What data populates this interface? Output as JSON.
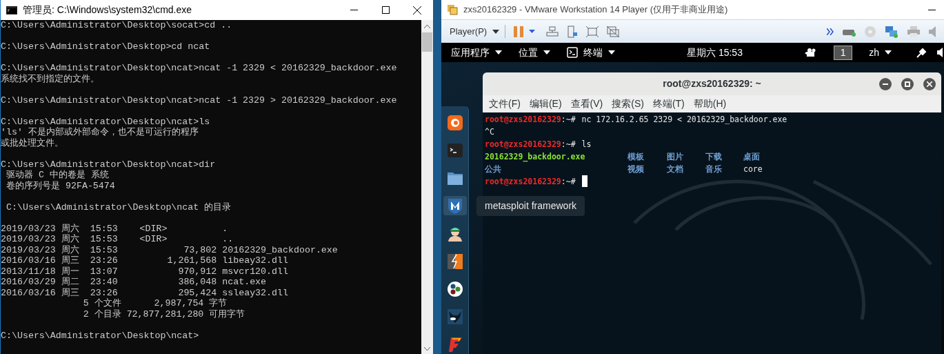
{
  "cmd_window": {
    "title": "管理员: C:\\Windows\\system32\\cmd.exe",
    "blocks": [
      [
        "C:\\Users\\Administrator\\Desktop\\socat>cd .."
      ],
      [
        "C:\\Users\\Administrator\\Desktop>cd ncat"
      ],
      [
        "C:\\Users\\Administrator\\Desktop\\ncat>ncat -1 2329 < 20162329_backdoor.exe",
        "系统找不到指定的文件。"
      ],
      [
        "C:\\Users\\Administrator\\Desktop\\ncat>ncat -1 2329 > 20162329_backdoor.exe"
      ],
      [
        "C:\\Users\\Administrator\\Desktop\\ncat>ls",
        "'ls' 不是内部或外部命令，也不是可运行的程序",
        "或批处理文件。"
      ],
      [
        "C:\\Users\\Administrator\\Desktop\\ncat>dir",
        " 驱动器 C 中的卷是 系统",
        " 卷的序列号是 92FA-5474"
      ],
      [
        " C:\\Users\\Administrator\\Desktop\\ncat 的目录"
      ],
      [
        "2019/03/23 周六  15:53    <DIR>          .",
        "2019/03/23 周六  15:53    <DIR>          ..",
        "2019/03/23 周六  15:53            73,802 20162329_backdoor.exe",
        "2016/03/16 周三  23:26         1,261,568 libeay32.dll",
        "2013/11/18 周一  13:07           970,912 msvcr120.dll",
        "2016/03/29 周二  23:40           386,048 ncat.exe",
        "2016/03/16 周三  23:26           295,424 ssleay32.dll",
        "               5 个文件      2,987,754 字节",
        "               2 个目录 72,877,281,280 可用字节"
      ],
      [
        "C:\\Users\\Administrator\\Desktop\\ncat>"
      ]
    ]
  },
  "vm_window": {
    "title": "zxs20162329 - VMware Workstation 14 Player (仅用于非商业用途)",
    "player_menu": "Player(P)",
    "guest": {
      "top_bar": {
        "menus": [
          {
            "kind": "menu",
            "label": "应用程序"
          },
          {
            "kind": "menu",
            "label": "位置"
          },
          {
            "kind": "terminal",
            "label": "终端"
          }
        ],
        "clock": "星期六 15:53",
        "workspace": "1",
        "language": "zh"
      },
      "dock": [
        {
          "kind": "browser",
          "selected": false
        },
        {
          "kind": "terminal",
          "selected": false
        },
        {
          "kind": "folder",
          "selected": false
        },
        {
          "kind": "shield",
          "selected": true
        },
        {
          "kind": "figure",
          "selected": false
        },
        {
          "kind": "bolt",
          "selected": false
        },
        {
          "kind": "dots",
          "selected": false
        },
        {
          "kind": "bull",
          "selected": false
        },
        {
          "kind": "flag",
          "selected": false
        }
      ],
      "tooltip": "metasploit framework",
      "terminal": {
        "title": "root@zxs20162329: ~",
        "menu": [
          "文件(F)",
          "编辑(E)",
          "查看(V)",
          "搜索(S)",
          "终端(T)",
          "帮助(H)"
        ],
        "lines": [
          {
            "kind": "prompt",
            "user": "root@zxs20162329",
            "path": ":~#",
            "command": "nc 172.16.2.65 2329 < 20162329_backdoor.exe"
          },
          {
            "kind": "output",
            "text": "^C"
          },
          {
            "kind": "prompt",
            "user": "root@zxs20162329",
            "path": ":~#",
            "command": "ls"
          },
          {
            "kind": "listing",
            "cells": [
              {
                "kind": "exec",
                "text": "20162329_backdoor.exe"
              },
              {
                "kind": "dir",
                "text": "模板"
              },
              {
                "kind": "dir",
                "text": "图片"
              },
              {
                "kind": "dir",
                "text": "下载"
              },
              {
                "kind": "dir",
                "text": "桌面"
              }
            ]
          },
          {
            "kind": "listing",
            "cells": [
              {
                "kind": "dir",
                "text": "公共"
              },
              {
                "kind": "dir",
                "text": "视频"
              },
              {
                "kind": "dir",
                "text": "文档"
              },
              {
                "kind": "dir",
                "text": "音乐"
              },
              {
                "kind": "file",
                "text": "core"
              }
            ]
          },
          {
            "kind": "prompt",
            "user": "root@zxs20162329",
            "path": ":~#",
            "cursor": true
          }
        ]
      }
    }
  }
}
